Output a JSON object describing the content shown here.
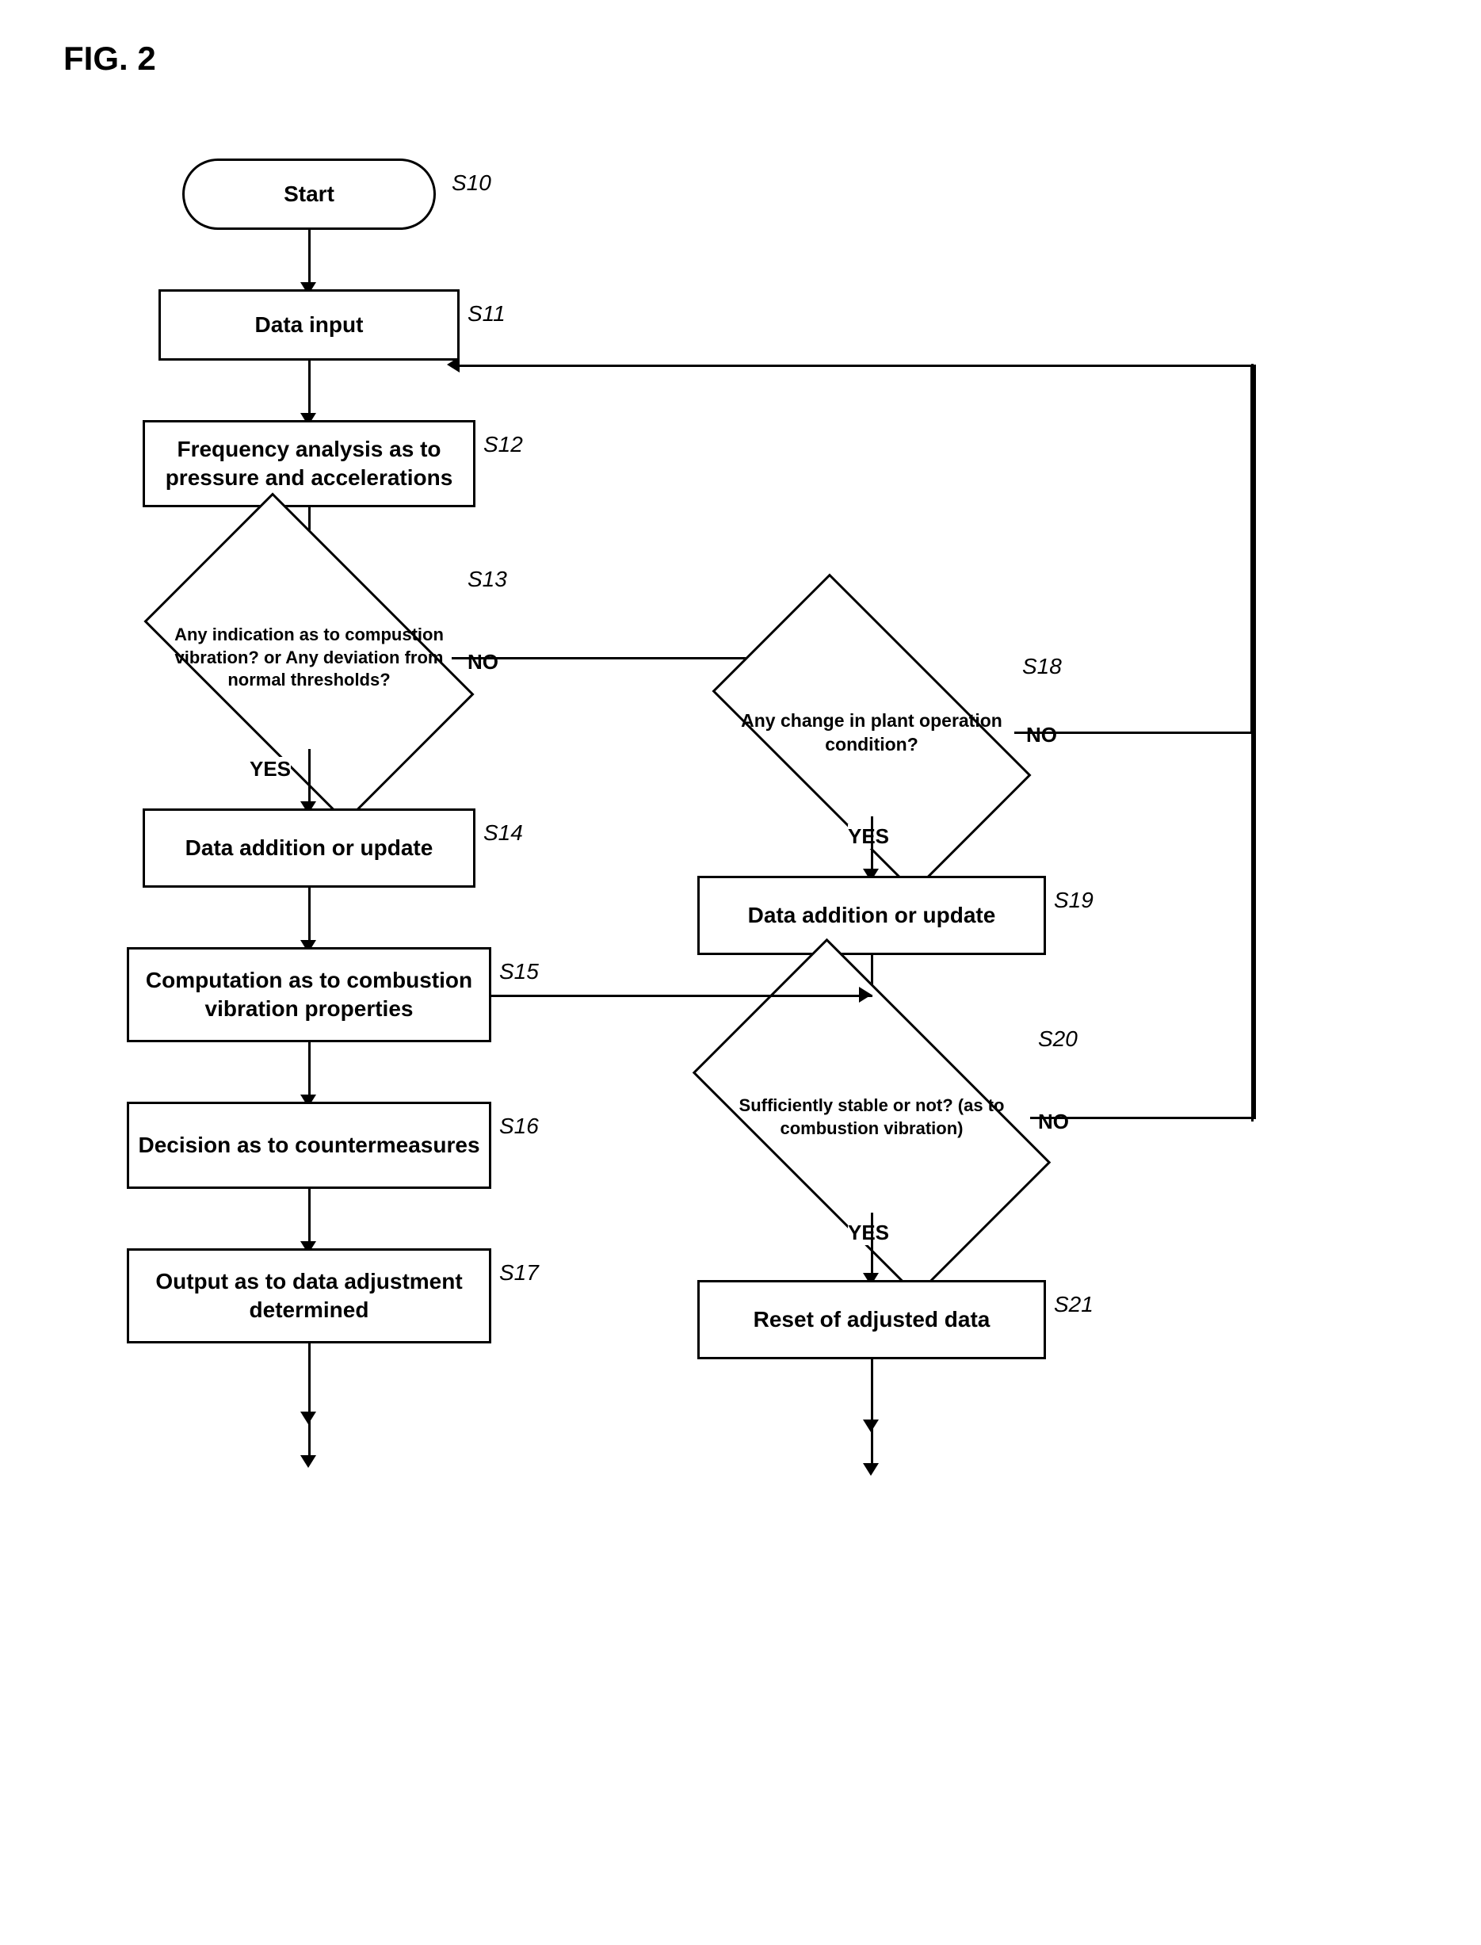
{
  "title": "FIG. 2",
  "steps": {
    "s10": {
      "label": "S10",
      "text": "Start"
    },
    "s11": {
      "label": "S11",
      "text": "Data input"
    },
    "s12": {
      "label": "S12",
      "text": "Frequency analysis as to\npressure and accelerations"
    },
    "s13": {
      "label": "S13",
      "text": "Any indication\nas to compustion vibration? or\nAny deviation from normal\nthresholds?"
    },
    "s14": {
      "label": "S14",
      "text": "Data addition\nor update"
    },
    "s15": {
      "label": "S15",
      "text": "Computation as to\ncombustion vibration\nproperties"
    },
    "s16": {
      "label": "S16",
      "text": "Decision as to\ncountermeasures"
    },
    "s17": {
      "label": "S17",
      "text": "Output as to data\nadjustment determined"
    },
    "s18": {
      "label": "S18",
      "text": "Any change in plant\noperation condition?"
    },
    "s19": {
      "label": "S19",
      "text": "Data addition\nor update"
    },
    "s20": {
      "label": "S20",
      "text": "Sufficiently stable or not?\n(as to combustion vibration)"
    },
    "s21": {
      "label": "S21",
      "text": "Reset of adjusted data"
    }
  },
  "labels": {
    "yes": "YES",
    "no": "NO"
  }
}
